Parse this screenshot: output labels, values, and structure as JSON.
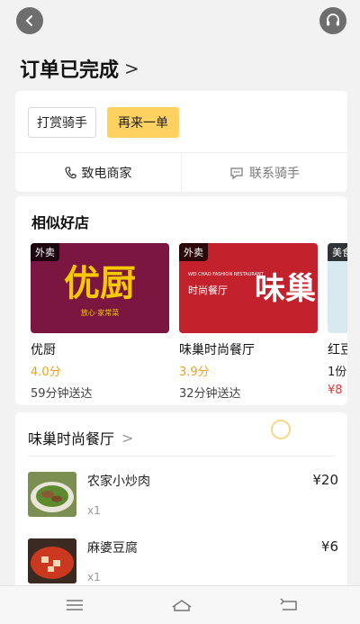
{
  "header": {
    "back_icon": "chevron-left-icon",
    "support_icon": "headset-icon",
    "title": "订单已完成",
    "title_chevron": ">"
  },
  "actions": {
    "tip_rider": "打赏骑手",
    "reorder": "再来一单",
    "call_merchant": "致电商家",
    "contact_rider": "联系骑手",
    "accent_color": "#ffd161"
  },
  "similar": {
    "title": "相似好店",
    "shops": [
      {
        "tag": "外卖",
        "logo_text": "优厨",
        "logo_sub": "放心·家常菜",
        "name": "优厨",
        "rating": "4.0分",
        "delivery": "59分钟送达"
      },
      {
        "tag": "外卖",
        "logo_text": "味巢",
        "logo_sub": "时尚餐厅",
        "logo_en": "WEI CHAO FASHION RESTAURANT",
        "name": "味巢时尚餐厅",
        "rating": "3.9分",
        "delivery": "32分钟送达"
      },
      {
        "tag": "美食",
        "name": "红豆",
        "rating": "1份",
        "price": "¥8"
      }
    ]
  },
  "order": {
    "restaurant": "味巢时尚餐厅",
    "chevron": ">",
    "items": [
      {
        "name": "农家小炒肉",
        "qty": "x1",
        "price": "¥20"
      },
      {
        "name": "麻婆豆腐",
        "qty": "x1",
        "price": "¥6"
      }
    ]
  },
  "navbar": {
    "menu_icon": "menu-icon",
    "home_icon": "home-icon",
    "back_icon": "return-icon"
  }
}
